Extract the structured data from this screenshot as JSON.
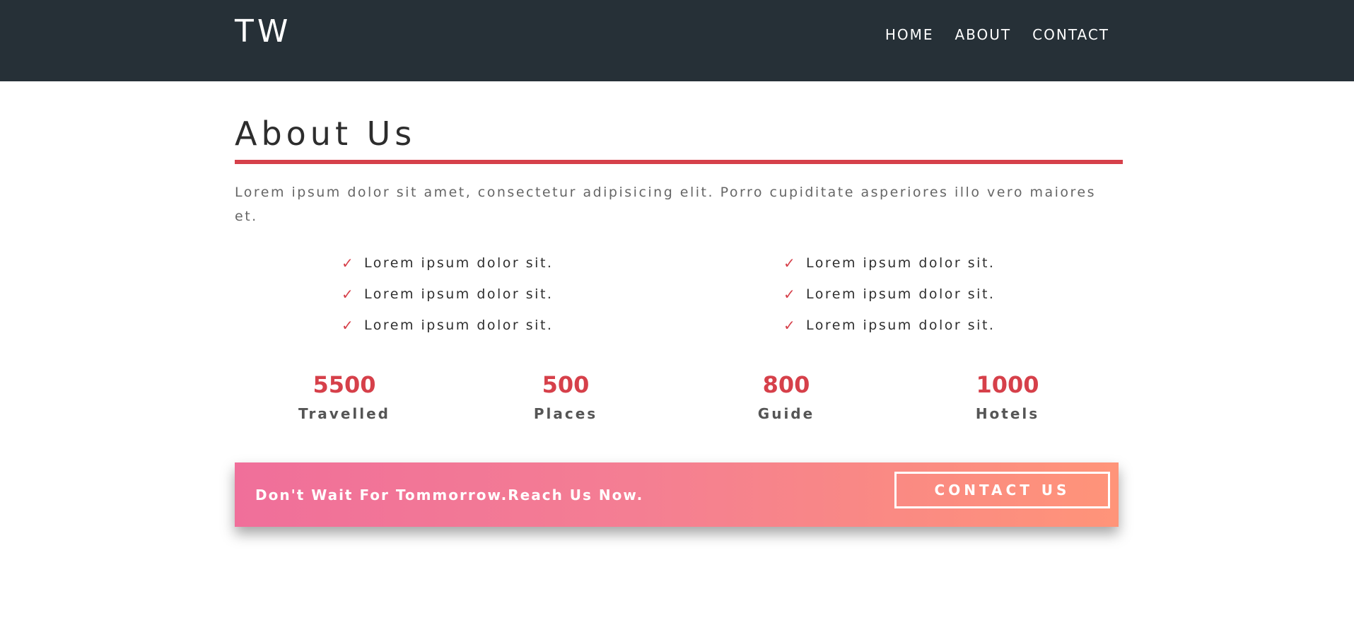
{
  "header": {
    "logo": "TW",
    "nav": [
      "HOME",
      "ABOUT",
      "CONTACT"
    ]
  },
  "about": {
    "title": "About Us",
    "intro": "Lorem ipsum dolor sit amet, consectetur adipisicing elit. Porro cupiditate asperiores illo vero maiores et.",
    "check_icon": "check-icon",
    "list_left": [
      "Lorem ipsum dolor sit.",
      "Lorem ipsum dolor sit.",
      "Lorem ipsum dolor sit."
    ],
    "list_right": [
      "Lorem ipsum dolor sit.",
      "Lorem ipsum dolor sit.",
      "Lorem ipsum dolor sit."
    ]
  },
  "stats": [
    {
      "value": "5500",
      "label": "Travelled"
    },
    {
      "value": "500",
      "label": "Places"
    },
    {
      "value": "800",
      "label": "Guide"
    },
    {
      "value": "1000",
      "label": "Hotels"
    }
  ],
  "cta": {
    "text": "Don't Wait For Tommorrow.Reach Us Now.",
    "button": "CONTACT US"
  },
  "colors": {
    "navbar": "#263037",
    "accent": "#d6404a",
    "gradient_start": "#f06f9a",
    "gradient_end": "#ff9479"
  }
}
